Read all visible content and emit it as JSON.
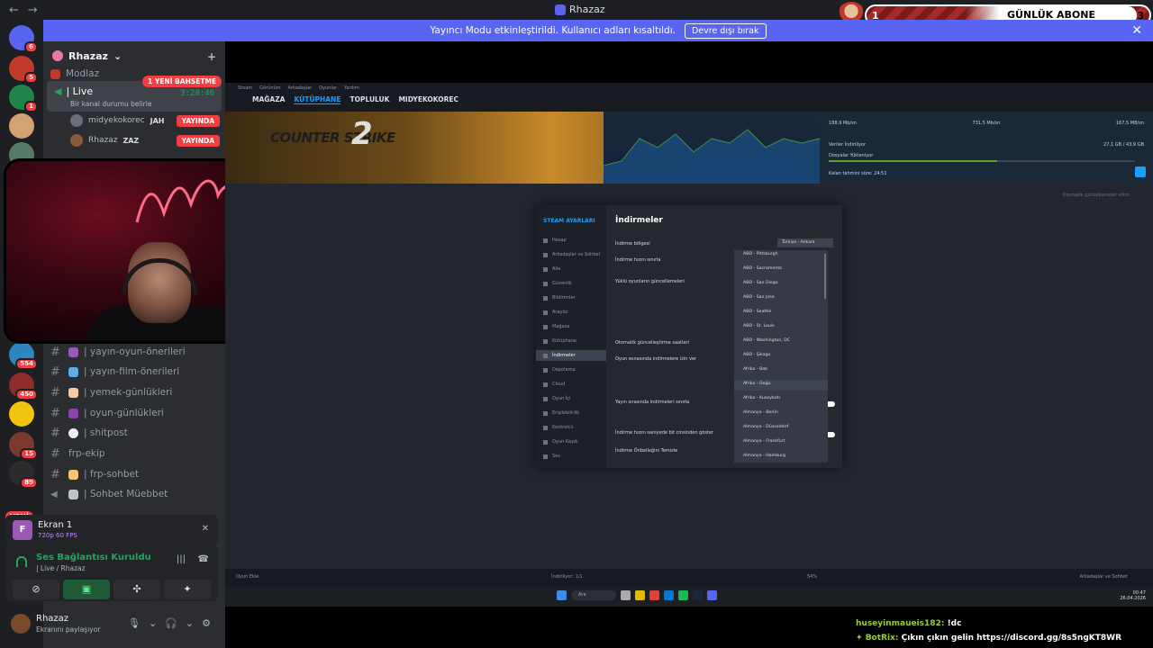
{
  "window": {
    "title": "Rhazaz",
    "back_arrow": "←",
    "forward_arrow": "→"
  },
  "sub_widget": {
    "left": "1",
    "label": "GÜNLÜK ABONE",
    "right": "3"
  },
  "banner": {
    "text": "Yayıncı Modu etkinleştirildi. Kullanıcı adları kısaltıldı.",
    "button": "Devre dışı bırak",
    "close": "✕"
  },
  "guilds": {
    "items": [
      {
        "name": "discord-home",
        "color": "#5865f2",
        "badge": "6"
      },
      {
        "name": "server-1",
        "color": "#c0392b",
        "badge": "5"
      },
      {
        "name": "server-2",
        "color": "#1e8449",
        "badge": "1"
      },
      {
        "name": "server-3",
        "color": "#d4a373",
        "badge": ""
      },
      {
        "name": "server-4",
        "color": "#557a6a",
        "badge": ""
      },
      {
        "name": "server-5",
        "color": "#2e86c1",
        "badge": "554"
      },
      {
        "name": "server-6",
        "color": "#8e2b2b",
        "badge": "450"
      },
      {
        "name": "server-7",
        "color": "#f1c40f",
        "badge": ""
      },
      {
        "name": "server-8",
        "color": "#7a3b2e",
        "badge": "15"
      },
      {
        "name": "server-9",
        "color": "#2c2c2c",
        "badge": "89"
      }
    ],
    "new_label": "YENİ"
  },
  "server": {
    "name": "Rhazaz",
    "chevron": "⌄",
    "add_icon": "+"
  },
  "channels": {
    "top": "Modlaz",
    "live": {
      "name": "| Live",
      "status": "Bir kanal durumu belirle",
      "timer": "3:28:46"
    },
    "mention": "1 YENİ BAHSETME",
    "users": [
      {
        "name": "midyekokorec",
        "tag": "JAH",
        "badge": "YAYINDA"
      },
      {
        "name": "Rhazaz",
        "tag": "ZAZ",
        "badge": "YAYINDA"
      }
    ],
    "list": [
      {
        "label": "| yayın-oyun-önerileri",
        "emoji_color": "#9b59b6"
      },
      {
        "label": "| yayın-film-önerileri",
        "emoji_color": "#5dade2"
      },
      {
        "label": "| yemek-günlükleri",
        "emoji_color": "#f5cba7"
      },
      {
        "label": "| oyun-günlükleri",
        "emoji_color": "#8e44ad"
      },
      {
        "label": "| shitpost",
        "emoji_color": "#ecf0f1"
      },
      {
        "label": "frp-ekip",
        "emoji_color": ""
      },
      {
        "label": "| frp-sohbet",
        "emoji_color": "#f8c471"
      },
      {
        "label": "| Sohbet Müebbet",
        "emoji_color": "#bdc3c7"
      }
    ]
  },
  "screen_share": {
    "icon_letter": "F",
    "name": "Ekran 1",
    "quality": "720p 60 FPS"
  },
  "voice": {
    "title": "Ses Bağlantısı Kuruldu",
    "subtitle": "| Live / Rhazaz"
  },
  "user": {
    "name": "Rhazaz",
    "status": "Ekranını paylaşıyor"
  },
  "steam": {
    "menu": [
      "Steam",
      "Görünüm",
      "Arkadaşlar",
      "Oyunlar",
      "Yardım"
    ],
    "nav": [
      "MAĞAZA",
      "KÜTÜPHANE",
      "TOPLULUK",
      "MIDYEKOKOREC"
    ],
    "hero_logo": "COUNTER STRIKE",
    "hero_logo_2": "2",
    "stats": {
      "cur": "188,9 Mb/sn",
      "peak": "731,5 Mb/sn",
      "disk": "167,5 MB/sn",
      "downloaded": "Veriler İndiriliyor",
      "progress": "27,1 GB / 43,9 GB",
      "files": "Dosyalar Yükleniyor",
      "remaining": "Kalan tahmini süre: 24:51",
      "auto": "Otomatik güncellemeler etkin"
    },
    "settings": {
      "heading": "STEAM AYARLARI",
      "title": "İndirmeler",
      "sidebar": [
        "Hesap",
        "Arkadaşlar ve Sohbet",
        "Aile",
        "Güvenlik",
        "Bildirimler",
        "Arayüz",
        "Mağaza",
        "Kütüphane",
        "İndirmeler",
        "Depolama",
        "Cloud",
        "Oyun İçi",
        "Erişilebilirlik",
        "Kontrolcü",
        "Oyun Kaydı",
        "Ses"
      ],
      "region_label": "İndirme bölgesi",
      "region_value": "Türkiye - Ankara",
      "limit_label": "İndirme hızını sınırla",
      "updates_label": "Yüklü oyunların güncellemeleri",
      "schedule_label": "Otomatik güncelleştirme saatleri",
      "during_label": "Oyun esnasında indirmelere izin ver",
      "stream_label": "Yayın sırasında indirmeleri sınırla",
      "bits_label": "İndirme hızını saniyede bit cinsinden göster",
      "cache_label": "İndirme Önbelleğini Temizle",
      "options": [
        "ABD - Pittsburgh",
        "ABD - Sacramento",
        "ABD - San Diego",
        "ABD - San Jose",
        "ABD - Seattle",
        "ABD - St. Louis",
        "ABD - Washington, DC",
        "ABD - Şikago",
        "Afrika - Batı",
        "Afrika - Doğu",
        "Afrika - Kuzeybatı",
        "Almanya - Berlin",
        "Almanya - Düsseldorf",
        "Almanya - Frankfurt",
        "Almanya - Hamburg"
      ]
    },
    "bottom_left": "Oyun Ekle",
    "bottom_mid": "İndiriliyor: 1/1",
    "bottom_pct": "54%",
    "bottom_right": "Arkadaşlar ve Sohbet",
    "taskbar_search": "Ara",
    "clock": "00:47",
    "date": "26.04.2026"
  },
  "chat": [
    {
      "user": "huseyinmaueis182:",
      "msg": "!dc"
    },
    {
      "user": "BotRix:",
      "msg": "Çıkın çıkın gelin https://discord.gg/8s5ngKT8WR"
    }
  ]
}
